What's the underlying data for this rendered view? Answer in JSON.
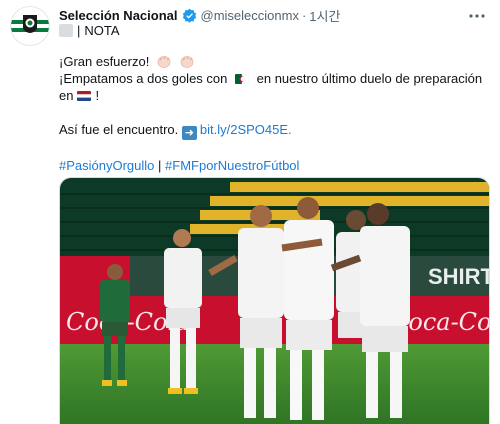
{
  "tweet": {
    "display_name": "Selección Nacional",
    "handle": "@miseleccionmx",
    "separator": "·",
    "time": "1시간",
    "nota_separator": "|",
    "nota_label": "NOTA",
    "line1": "¡Gran esfuerzo!",
    "line2a": "¡Empatamos a dos goles con",
    "line2b": "en nuestro último duelo de preparación",
    "line3a": "en",
    "line3b": "!",
    "line4": "Así fue el encuentro.",
    "link": "bit.ly/2SPO45E.",
    "hashtag1": "#PasiónyOrgullo",
    "hashtag_separator": "|",
    "hashtag2": "#FMFporNuestroFútbol"
  },
  "photo": {
    "board_text": "SHIRT M",
    "ad_text": "Coca-Cola"
  },
  "colors": {
    "link": "#1b7bd6",
    "verified": "#1d9bf0",
    "pitch": "#3f8a2e",
    "ad_board": "#c8102e"
  },
  "icons": [
    "avatar-crest-icon",
    "verified-icon",
    "more-icon",
    "emoji-placeholder-icon",
    "clap-icon",
    "algeria-flag-icon",
    "netherlands-flag-icon",
    "arrow-right-icon"
  ]
}
